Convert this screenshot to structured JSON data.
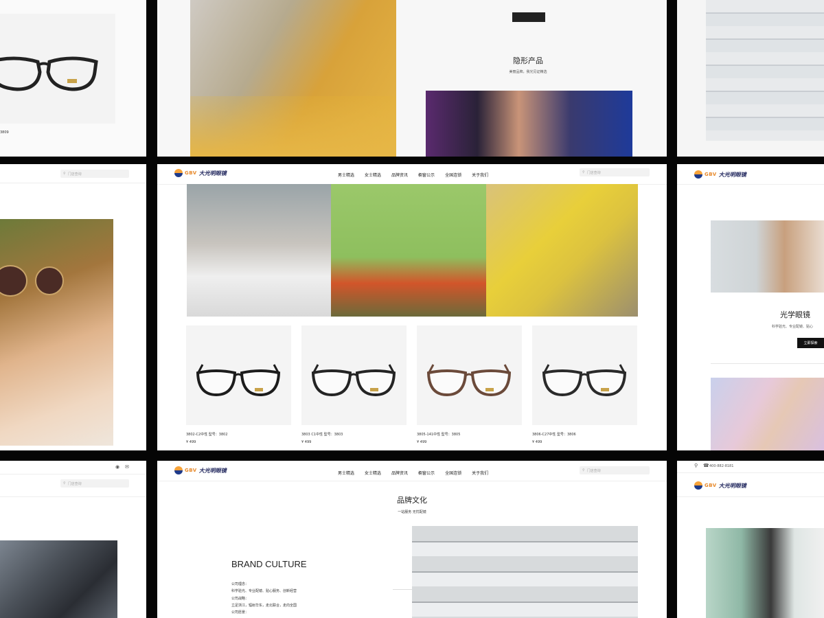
{
  "brand": {
    "logo_en": "GBV",
    "logo_cn": "大光明眼镜"
  },
  "nav": {
    "items": [
      "男士精选",
      "女士精选",
      "品牌资讯",
      "橱窗公示",
      "全国连锁",
      "关于我们"
    ],
    "search_placeholder": "门店查询"
  },
  "products": [
    {
      "caption": "3802-C2中性 型号：3802",
      "price": "¥ 499",
      "frame_color": "#1c1c1c"
    },
    {
      "caption": "3803 C1中性 型号：3803",
      "price": "¥ 499",
      "frame_color": "#242424"
    },
    {
      "caption": "3805-141中性 型号：3805",
      "price": "¥ 499",
      "frame_color": "#6b4a3a"
    },
    {
      "caption": "3806-C27中性 型号：3806",
      "price": "¥ 499",
      "frame_color": "#2a2a2a"
    }
  ],
  "top_left": {
    "caption": "3809"
  },
  "top_center": {
    "title": "隐形产品",
    "subtitle": "美丽品牌，我光见证精选"
  },
  "right_mid": {
    "title": "光学眼镜",
    "subtitle": "科学验光、专业配镜、贴心",
    "button": "立即探索"
  },
  "brand_culture": {
    "title": "品牌文化",
    "subtitle": "一站服务 无忧配镜",
    "en_title": "BRAND CULTURE",
    "lines": [
      "公司理念：",
      "科学验光、专业配镜、贴心服务、创新经营",
      "公司战略：",
      "立足浙江，辐射华东，走北联合，走向全国",
      "公司愿景："
    ]
  },
  "right_bottom": {
    "phone": "400-882-8181"
  },
  "colors": {
    "accent": "#e7892b",
    "brand_blue": "#23295f",
    "frame": "#000000"
  }
}
